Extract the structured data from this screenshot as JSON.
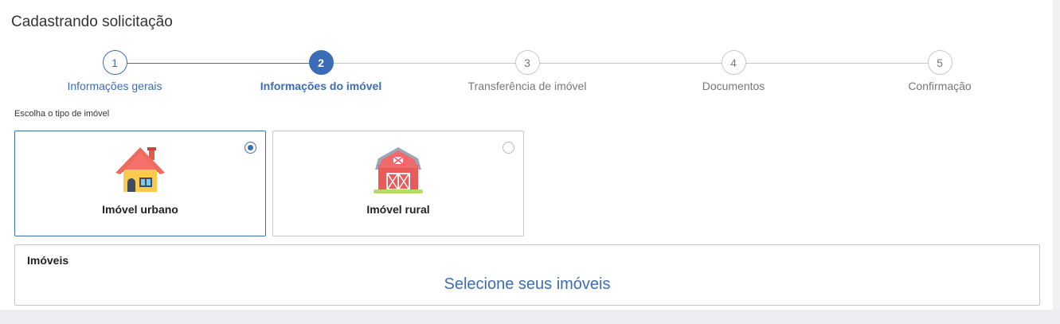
{
  "page": {
    "title": "Cadastrando solicitação"
  },
  "stepper": {
    "steps": [
      {
        "number": "1",
        "label": "Informações gerais",
        "state": "done"
      },
      {
        "number": "2",
        "label": "Informações do imóvel",
        "state": "active"
      },
      {
        "number": "3",
        "label": "Transferência de imóvel",
        "state": "pending"
      },
      {
        "number": "4",
        "label": "Documentos",
        "state": "pending"
      },
      {
        "number": "5",
        "label": "Confirmação",
        "state": "pending"
      }
    ]
  },
  "property_type": {
    "label": "Escolha o tipo de imóvel",
    "options": [
      {
        "label": "Imóvel urbano",
        "icon": "house-icon",
        "selected": true
      },
      {
        "label": "Imóvel rural",
        "icon": "barn-icon",
        "selected": false
      }
    ]
  },
  "imoveis": {
    "title": "Imóveis",
    "select_link": "Selecione seus imóveis"
  },
  "colors": {
    "accent": "#3a6db5",
    "inactive": "#777777",
    "border": "#c5c5c5",
    "background": "#eeeef2"
  }
}
